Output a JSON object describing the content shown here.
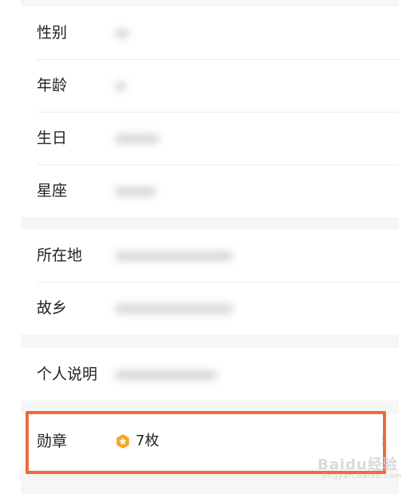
{
  "profile": {
    "basic_rows": [
      {
        "label": "性别"
      },
      {
        "label": "年龄"
      },
      {
        "label": "生日"
      },
      {
        "label": "星座"
      }
    ],
    "location_rows": [
      {
        "label": "所在地"
      },
      {
        "label": "故乡"
      }
    ],
    "bio_row": {
      "label": "个人说明"
    },
    "medal_row": {
      "label": "勋章",
      "icon": "medal-star-icon",
      "count": "7枚"
    }
  },
  "watermark": {
    "text": "Baidu经验",
    "sub": "jingyan.baidu.com"
  },
  "colors": {
    "highlight": "#f06a3c",
    "medal": "#f5a623",
    "background": "#f6f6f7",
    "card": "#ffffff",
    "text": "#222222"
  }
}
